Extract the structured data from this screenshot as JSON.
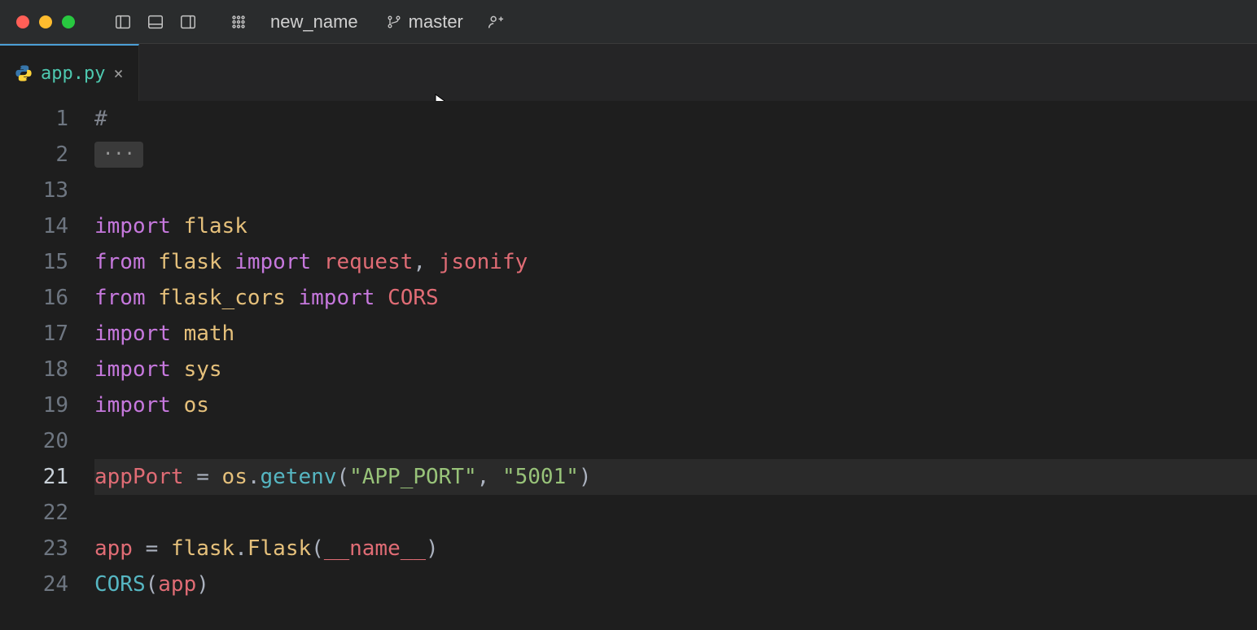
{
  "titlebar": {
    "project": "new_name",
    "branch": "master"
  },
  "tab": {
    "filename": "app.py"
  },
  "gutter": [
    "1",
    "2",
    "13",
    "14",
    "15",
    "16",
    "17",
    "18",
    "19",
    "20",
    "21",
    "22",
    "23",
    "24"
  ],
  "currentLineIndex": 10,
  "code": {
    "l1_comment": "#",
    "fold": "···",
    "l14_kw": "import",
    "l14_mod": "flask",
    "l15_kw1": "from",
    "l15_mod": "flask",
    "l15_kw2": "import",
    "l15_id1": "request",
    "l15_pun": ", ",
    "l15_id2": "jsonify",
    "l16_kw1": "from",
    "l16_mod": "flask_cors",
    "l16_kw2": "import",
    "l16_id": "CORS",
    "l17_kw": "import",
    "l17_mod": "math",
    "l18_kw": "import",
    "l18_mod": "sys",
    "l19_kw": "import",
    "l19_mod": "os",
    "l21_id": "appPort",
    "l21_eq": " = ",
    "l21_mod": "os",
    "l21_dot": ".",
    "l21_fn": "getenv",
    "l21_op": "(",
    "l21_s1": "\"APP_PORT\"",
    "l21_cm": ", ",
    "l21_s2": "\"5001\"",
    "l21_cp": ")",
    "l23_id": "app",
    "l23_eq": " = ",
    "l23_mod": "flask",
    "l23_dot": ".",
    "l23_cls": "Flask",
    "l23_op": "(",
    "l23_arg": "__name__",
    "l23_cp": ")",
    "l24_fn": "CORS",
    "l24_op": "(",
    "l24_arg": "app",
    "l24_cp": ")"
  }
}
